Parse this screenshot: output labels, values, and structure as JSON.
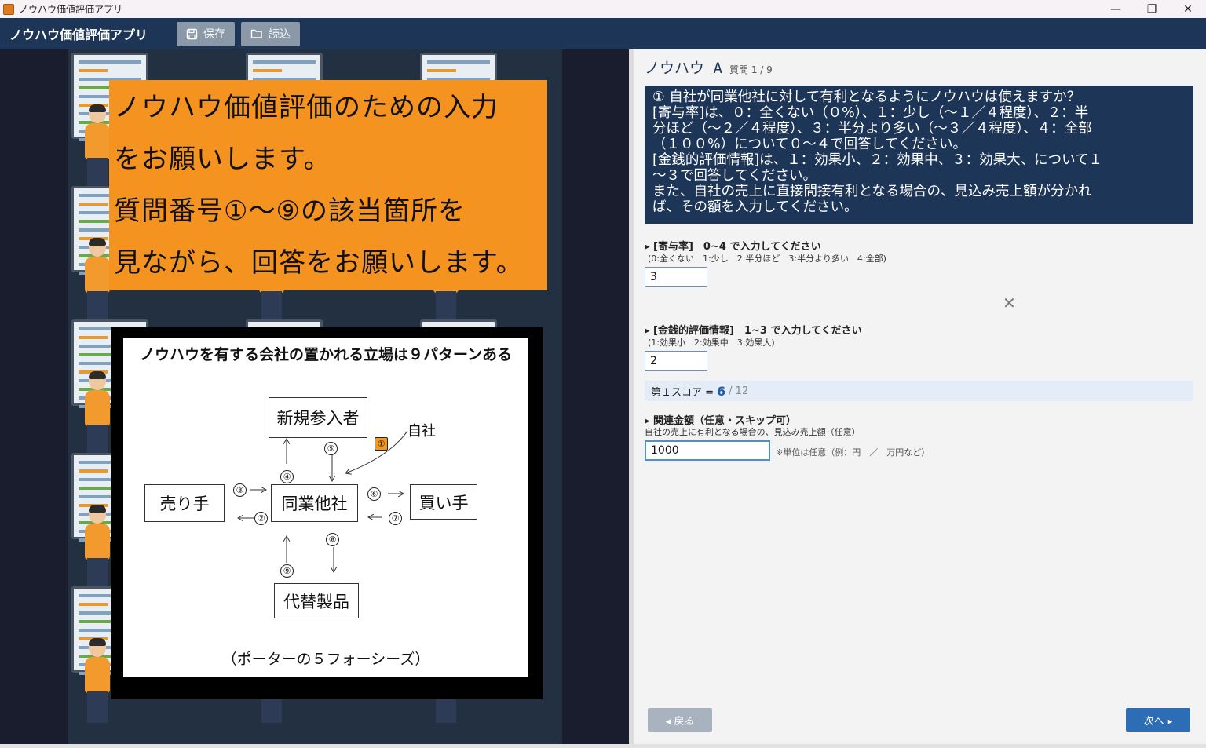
{
  "window": {
    "title": "ノウハウ価値評価アプリ",
    "controls": {
      "minimize": "—",
      "restore": "❐",
      "close": "✕"
    }
  },
  "header": {
    "title": "ノウハウ価値評価アプリ",
    "save_label": "保存",
    "load_label": "読込"
  },
  "left_panel": {
    "banner_lines": [
      "ノウハウ価値評価のための入力",
      "をお願いします。",
      "質問番号①～⑨の該当箇所を",
      "見ながら、回答をお願いします。"
    ],
    "diagram": {
      "title": "ノウハウを有する会社の置かれる立場は９パターンある",
      "boxes": {
        "new_entrant": "新規参入者",
        "seller": "売り手",
        "competitor": "同業他社",
        "buyer": "買い手",
        "substitute": "代替製品"
      },
      "self_label": "自社",
      "numbers": [
        "①",
        "②",
        "③",
        "④",
        "⑤",
        "⑥",
        "⑦",
        "⑧",
        "⑨"
      ],
      "caption": "（ポーターの５フォーシーズ）"
    }
  },
  "right_panel": {
    "title": "ノウハウ A",
    "progress": "質問 1 / 9",
    "question_lines": [
      "① 自社が同業他社に対して有利となるようにノウハウは使えますか？",
      "[寄与率]は、０：全くない（０%）、１：少し（～１／４程度）、２：半",
      "分ほど（～２／４程度）、３：半分より多い（～３／４程度）、４：全部",
      "（１００%）について０～４で回答してください。",
      "[金銭的評価情報]は、１：効果小、２：効果中、３：効果大、について１",
      "～３で回答してください。",
      "また、自社の売上に直接間接有利となる場合の、見込み売上額が分かれ",
      "ば、その額を入力してください。"
    ],
    "contribution": {
      "label": "▸ [寄与率]　0~4 で入力してください",
      "hint": "(0:全くない　1:少し　2:半分ほど　3:半分より多い　4:全部)",
      "value": "3"
    },
    "close_icon": "✕",
    "monetary": {
      "label": "▸ [金銭的評価情報]　1~3 で入力してください",
      "hint": "(1:効果小　2:効果中　3:効果大)",
      "value": "2"
    },
    "score": {
      "label": "第１スコア =",
      "value": "6",
      "max": "/ 12"
    },
    "sales": {
      "label": "▸ 関連金額（任意・スキップ可）",
      "hint": "自社の売上に有利となる場合の、見込み売上額（任意）",
      "value": "1000",
      "unit_note": "※単位は任意（例：円　／　万円など）"
    },
    "back_label": "◂ 戻る",
    "next_label": "次へ ▸"
  }
}
